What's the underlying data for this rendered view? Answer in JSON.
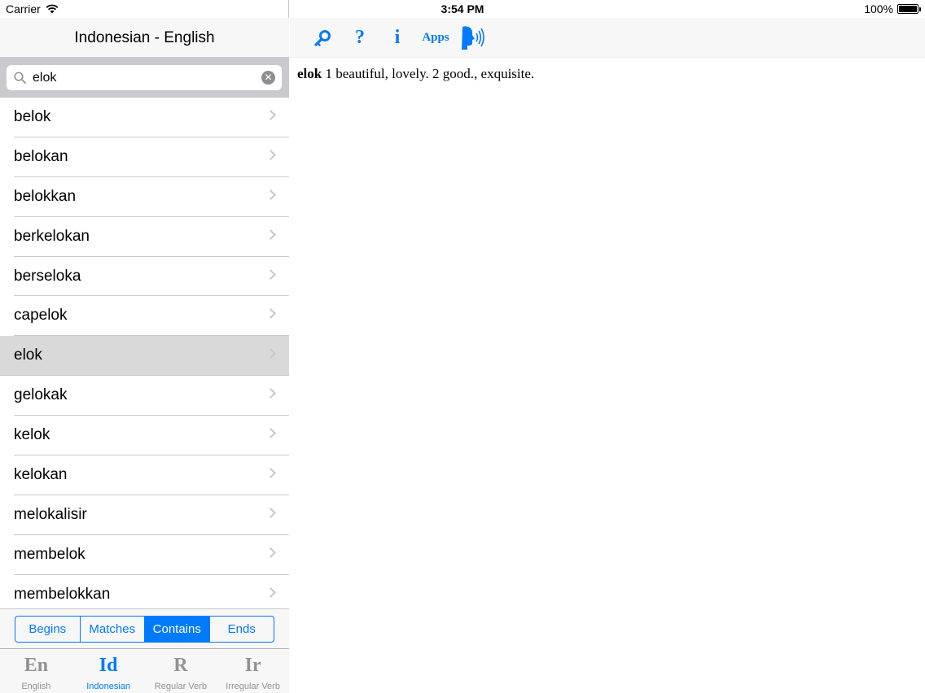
{
  "status_bar": {
    "carrier": "Carrier",
    "time": "3:54 PM",
    "battery": "100%"
  },
  "left_nav": {
    "title": "Indonesian - English"
  },
  "search": {
    "value": "elok"
  },
  "word_list": [
    {
      "word": "belok"
    },
    {
      "word": "belokan"
    },
    {
      "word": "belokkan"
    },
    {
      "word": "berkelokan"
    },
    {
      "word": "berseloka"
    },
    {
      "word": "capelok"
    },
    {
      "word": "elok",
      "selected": true
    },
    {
      "word": "gelokak"
    },
    {
      "word": "kelok"
    },
    {
      "word": "kelokan"
    },
    {
      "word": "melokalisir"
    },
    {
      "word": "membelok"
    },
    {
      "word": "membelokkan"
    }
  ],
  "segments": [
    "Begins",
    "Matches",
    "Contains",
    "Ends"
  ],
  "active_segment": "Contains",
  "tabs": [
    {
      "icon": "En",
      "label": "English"
    },
    {
      "icon": "Id",
      "label": "Indonesian",
      "active": true
    },
    {
      "icon": "R",
      "label": "Regular Verb"
    },
    {
      "icon": "Ir",
      "label": "Irregular Verb"
    }
  ],
  "toolbar": {
    "help": "?",
    "info": "i",
    "apps": "Apps"
  },
  "definition": {
    "headword": "elok",
    "text": " 1 beautiful, lovely. 2 good., exquisite."
  },
  "colors": {
    "accent": "#007aff",
    "selected_row": "#d9d9d9"
  }
}
